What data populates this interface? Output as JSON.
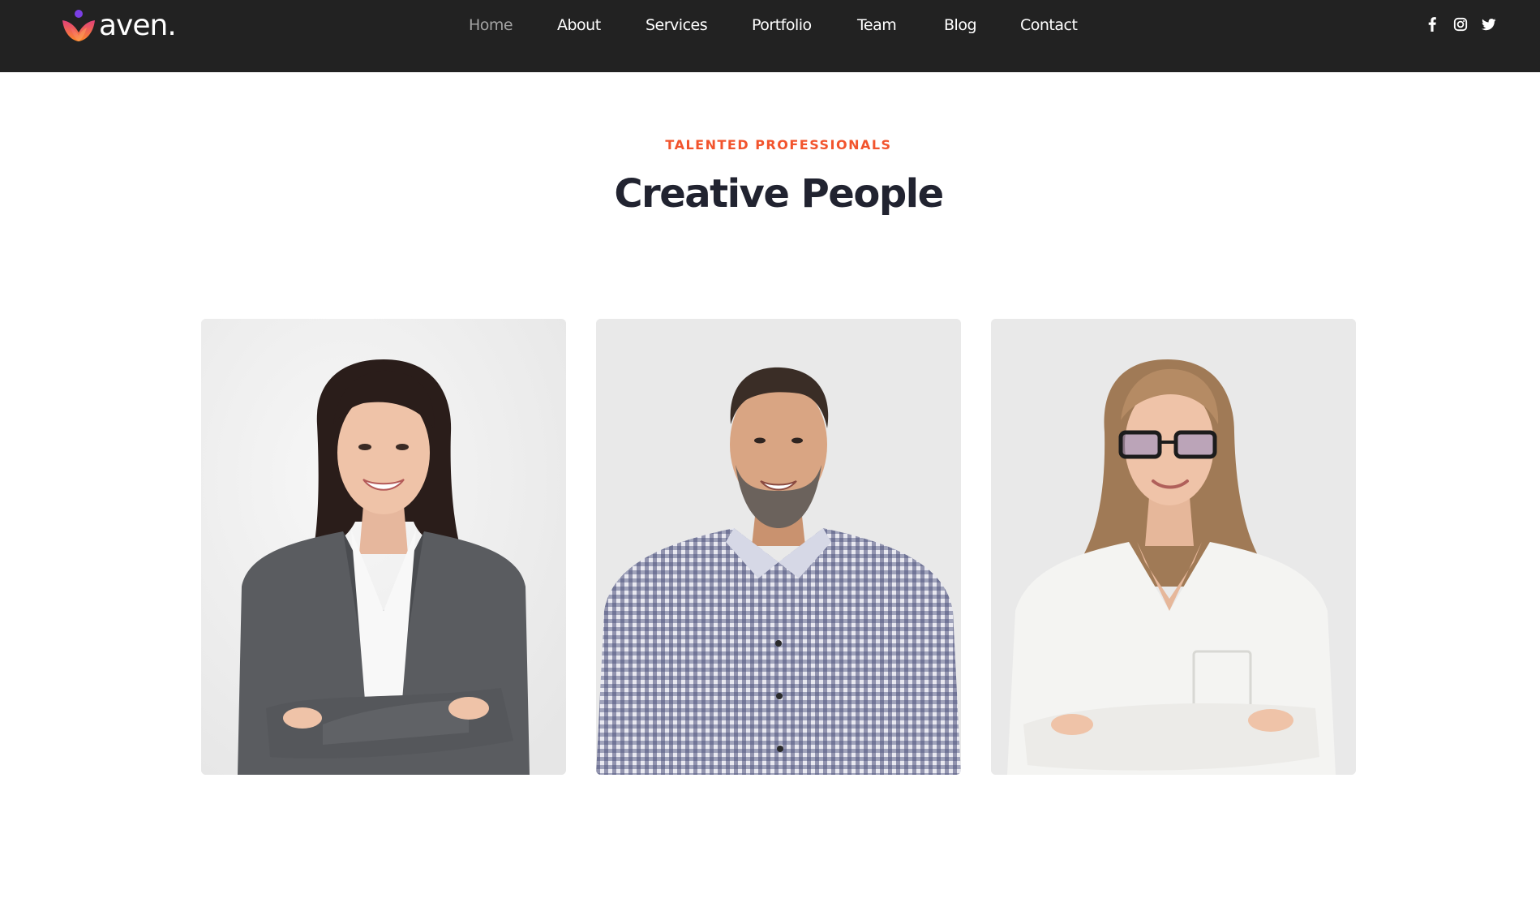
{
  "header": {
    "logo_text": "aven.",
    "nav": [
      {
        "label": "Home",
        "active": true
      },
      {
        "label": "About",
        "active": false
      },
      {
        "label": "Services",
        "active": false
      },
      {
        "label": "Portfolio",
        "active": false
      },
      {
        "label": "Team",
        "active": false
      },
      {
        "label": "Blog",
        "active": false
      },
      {
        "label": "Contact",
        "active": false
      }
    ],
    "social_icons": [
      "facebook-icon",
      "instagram-icon",
      "twitter-icon"
    ]
  },
  "section": {
    "eyebrow": "TALENTED PROFESSIONALS",
    "title": "Creative People"
  },
  "team": [
    {
      "photo": "woman-dark-bob-grey-blazer-photo"
    },
    {
      "photo": "man-beard-checked-shirt-photo"
    },
    {
      "photo": "woman-glasses-white-blouse-photo"
    }
  ],
  "colors": {
    "header_bg": "#222222",
    "accent": "#f2542d",
    "heading": "#212330",
    "nav_active": "#a3a3a3",
    "logo_gradient": [
      "#7b2ff7",
      "#f2542d",
      "#ffb347"
    ]
  }
}
